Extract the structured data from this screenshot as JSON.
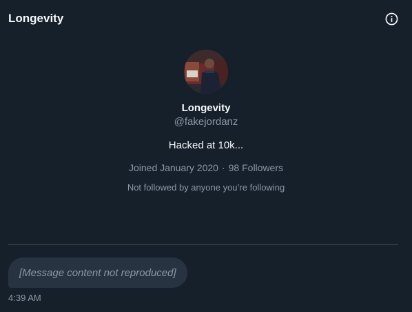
{
  "header": {
    "title": "Longevity",
    "info_icon": "info-icon"
  },
  "profile": {
    "name": "Longevity",
    "handle": "@fakejordanz",
    "bio": "Hacked at 10k...",
    "joined": "Joined January 2020",
    "separator": "·",
    "followers": "98 Followers",
    "followed_note": "Not followed by anyone you’re following"
  },
  "message": {
    "text": "[Message content not reproduced]",
    "time": "4:39 AM"
  },
  "colors": {
    "background": "#15202b",
    "bubble": "#273340",
    "muted_text": "#8b98a5",
    "divider": "#38444d"
  }
}
